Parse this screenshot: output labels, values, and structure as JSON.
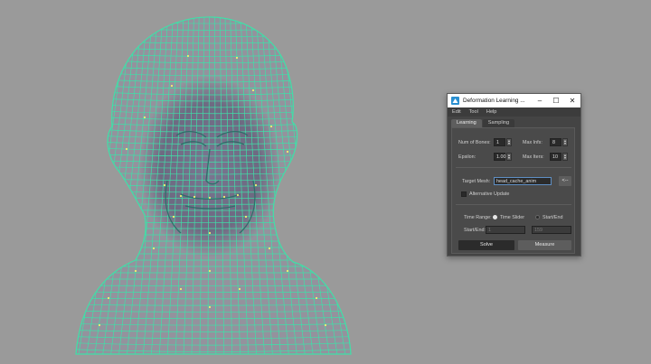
{
  "colors": {
    "background": "#9a9a9a",
    "wire": "#3fe0a8",
    "mesh_shade": "#6e6886",
    "joint": "#f2f070"
  },
  "dialog": {
    "title": "Deformation Learning ...",
    "menu": [
      "Edit",
      "Tool",
      "Help"
    ],
    "tabs": [
      "Learning",
      "Sampling"
    ],
    "num_bones_label": "Num of Bones:",
    "num_bones_value": "1",
    "max_infs_label": "Max Infs:",
    "max_infs_value": "8",
    "epsilon_label": "Epsilon:",
    "epsilon_value": "1.00",
    "max_iters_label": "Max Iters:",
    "max_iters_value": "10",
    "target_mesh_label": "Target Mesh:",
    "target_mesh_value": "head_cache_anim",
    "pick_button": "<--",
    "alt_update_label": "Alternative Update",
    "time_range_label": "Time Range:",
    "time_slider_label": "Time Slider",
    "start_end_label": "Start/End",
    "start_end_row_label": "Start/End:",
    "start_value": "1",
    "end_value": "159",
    "solve_button": "Solve",
    "measure_button": "Measure"
  }
}
